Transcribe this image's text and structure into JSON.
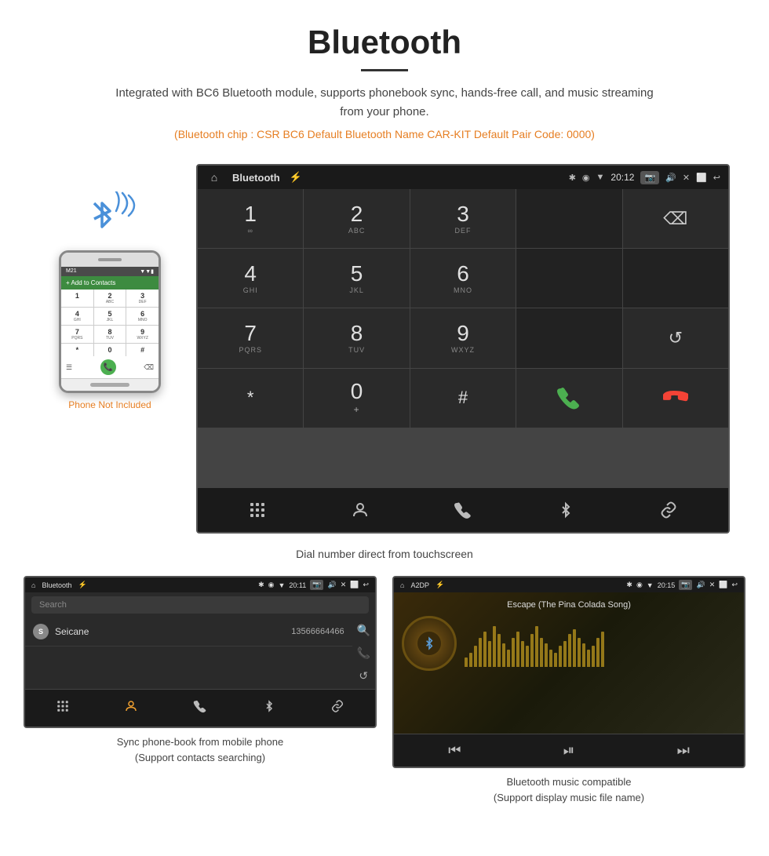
{
  "page": {
    "title": "Bluetooth",
    "divider": true,
    "description": "Integrated with BC6 Bluetooth module, supports phonebook sync, hands-free call, and music streaming from your phone.",
    "specs": "(Bluetooth chip : CSR BC6    Default Bluetooth Name CAR-KIT    Default Pair Code: 0000)"
  },
  "head_unit": {
    "status_bar": {
      "home_icon": "⌂",
      "app_title": "Bluetooth",
      "usb_icon": "⚡",
      "bt_icon": "✱",
      "location_icon": "◉",
      "signal_icon": "▼",
      "time": "20:12",
      "camera_icon": "📷",
      "volume_icon": "🔊",
      "close_icon": "✕",
      "window_icon": "⬜",
      "back_icon": "↩"
    },
    "dialpad": {
      "keys": [
        {
          "num": "1",
          "letters": "∞",
          "sub": ""
        },
        {
          "num": "2",
          "letters": "ABC",
          "sub": ""
        },
        {
          "num": "3",
          "letters": "DEF",
          "sub": ""
        },
        {
          "num": "",
          "letters": "",
          "sub": ""
        },
        {
          "num": "⌫",
          "letters": "",
          "sub": "backspace"
        },
        {
          "num": "4",
          "letters": "GHI",
          "sub": ""
        },
        {
          "num": "5",
          "letters": "JKL",
          "sub": ""
        },
        {
          "num": "6",
          "letters": "MNO",
          "sub": ""
        },
        {
          "num": "",
          "letters": "",
          "sub": ""
        },
        {
          "num": "",
          "letters": "",
          "sub": ""
        },
        {
          "num": "7",
          "letters": "PQRS",
          "sub": ""
        },
        {
          "num": "8",
          "letters": "TUV",
          "sub": ""
        },
        {
          "num": "9",
          "letters": "WXYZ",
          "sub": ""
        },
        {
          "num": "",
          "letters": "",
          "sub": ""
        },
        {
          "num": "↺",
          "letters": "",
          "sub": "refresh"
        },
        {
          "num": "*",
          "letters": "",
          "sub": ""
        },
        {
          "num": "0",
          "letters": "+",
          "sub": ""
        },
        {
          "num": "#",
          "letters": "",
          "sub": ""
        },
        {
          "num": "📞",
          "letters": "",
          "sub": "call_green"
        },
        {
          "num": "📞",
          "letters": "",
          "sub": "call_red"
        }
      ]
    },
    "toolbar": {
      "dialpad_icon": "⠿",
      "contacts_icon": "👤",
      "phone_icon": "📞",
      "bt_icon": "✱",
      "link_icon": "🔗"
    }
  },
  "phone_mockup": {
    "status": "Add to Contacts",
    "keys": [
      "1",
      "2",
      "3",
      "4",
      "5",
      "6",
      "7",
      "8",
      "9",
      "*",
      "0",
      "#"
    ],
    "not_included_label": "Phone Not Included"
  },
  "caption_main": "Dial number direct from touchscreen",
  "phonebook_screen": {
    "status_bar": {
      "app_title": "Bluetooth",
      "time": "20:11"
    },
    "search_placeholder": "Search",
    "contacts": [
      {
        "letter": "S",
        "name": "Seicane",
        "number": "13566664466"
      }
    ],
    "right_icons": [
      "🔍",
      "📞",
      "↺"
    ],
    "toolbar": [
      "⠿",
      "👤",
      "📞",
      "✱",
      "🔗"
    ]
  },
  "music_screen": {
    "status_bar": {
      "app_title": "A2DP",
      "time": "20:15"
    },
    "song_title": "Escape (The Pina Colada Song)",
    "visualizer_bars": [
      8,
      12,
      18,
      25,
      30,
      22,
      35,
      28,
      20,
      15,
      25,
      30,
      22,
      18,
      28,
      35,
      25,
      20,
      15,
      12,
      18,
      22,
      28,
      32,
      25,
      20,
      15,
      18,
      25,
      30
    ],
    "toolbar": [
      "⏮",
      "⏯",
      "⏭"
    ]
  },
  "caption_phonebook": "Sync phone-book from mobile phone\n(Support contacts searching)",
  "caption_music": "Bluetooth music compatible\n(Support display music file name)"
}
